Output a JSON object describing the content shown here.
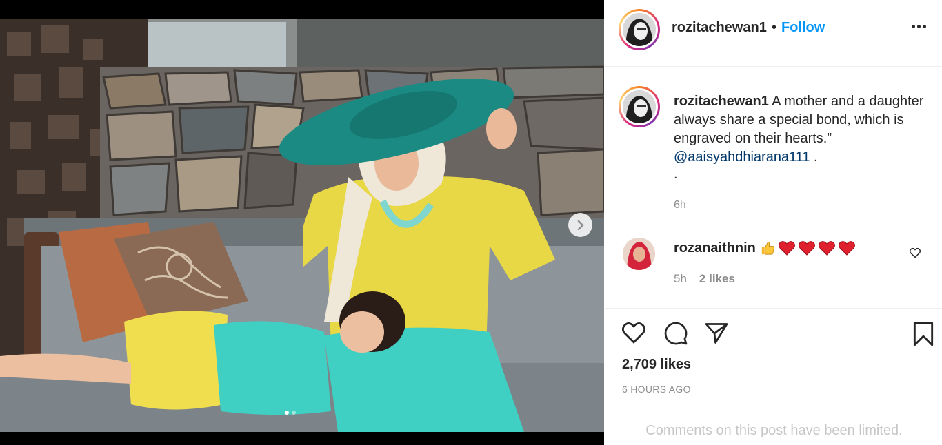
{
  "post": {
    "username": "rozitachewan1",
    "separator": "•",
    "follow_label": "Follow",
    "caption_text": "A mother and a daughter always share a special bond, which is engraved on their hearts.”",
    "caption_mention": "@aaisyahdhiarana111",
    "caption_mention_suffix": " .",
    "caption_dot": ".",
    "caption_time": "6h",
    "likes": "2,709 likes",
    "time_ago": "6 HOURS AGO",
    "comments_limited": "Comments on this post have been limited."
  },
  "comment": {
    "username": "rozanaithnin",
    "emojis": [
      "thumbs-up-emoji",
      "red-heart-emoji",
      "red-heart-emoji",
      "red-heart-emoji",
      "red-heart-emoji"
    ],
    "time": "5h",
    "likes": "2 likes"
  },
  "carousel": {
    "total_slides": 2,
    "active_slide": 1
  },
  "colors": {
    "link_blue": "#0095f6",
    "mention_blue": "#00376b",
    "muted_gray": "#8e8e8e",
    "heart_red": "#ed4956"
  }
}
